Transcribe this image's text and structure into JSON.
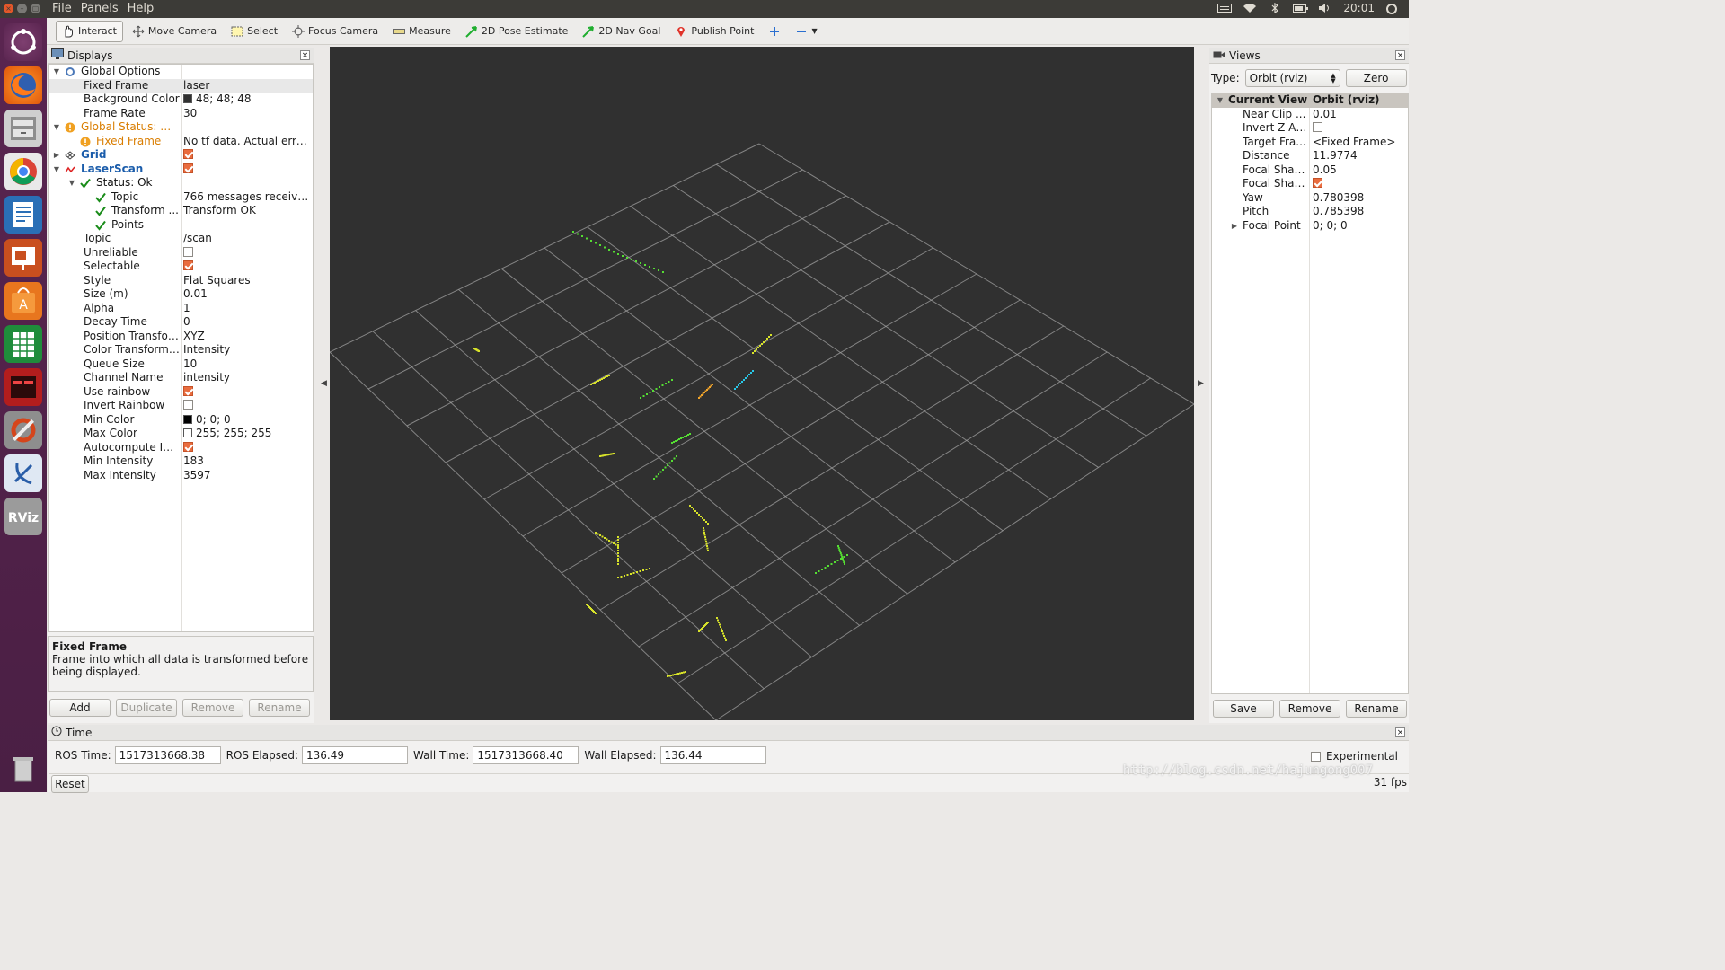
{
  "menubar": {
    "items": [
      "File",
      "Panels",
      "Help"
    ],
    "time": "20:01"
  },
  "toolbar": {
    "tools": [
      {
        "label": "Interact",
        "icon": "hand-icon",
        "active": true
      },
      {
        "label": "Move Camera",
        "icon": "move-camera-icon"
      },
      {
        "label": "Select",
        "icon": "select-icon"
      },
      {
        "label": "Focus Camera",
        "icon": "focus-camera-icon"
      },
      {
        "label": "Measure",
        "icon": "measure-icon"
      },
      {
        "label": "2D Pose Estimate",
        "icon": "pose-arrow-icon"
      },
      {
        "label": "2D Nav Goal",
        "icon": "nav-goal-arrow-icon"
      },
      {
        "label": "Publish Point",
        "icon": "map-pin-icon"
      }
    ]
  },
  "displays": {
    "title": "Displays",
    "rows": [
      {
        "name": "Global Options",
        "value": "",
        "indent": 0,
        "arrow": "down",
        "icon": "gear-icon"
      },
      {
        "name": "Fixed Frame",
        "value": "laser",
        "indent": 1,
        "selected": true
      },
      {
        "name": "Background Color",
        "value": "48; 48; 48",
        "indent": 1,
        "swatch": "#303030"
      },
      {
        "name": "Frame Rate",
        "value": "30",
        "indent": 1
      },
      {
        "name": "Global Status: W...",
        "value": "",
        "indent": 0,
        "arrow": "down",
        "icon": "warning-icon",
        "style": "warn"
      },
      {
        "name": "Fixed Frame",
        "value": "No tf data.  Actual erro...",
        "indent": 1,
        "icon": "warning-icon",
        "style": "warn"
      },
      {
        "name": "Grid",
        "value": "",
        "indent": 0,
        "arrow": "right",
        "icon": "grid-icon",
        "style": "blue",
        "check": true
      },
      {
        "name": "LaserScan",
        "value": "",
        "indent": 0,
        "arrow": "down",
        "icon": "laser-scan-icon",
        "style": "blue",
        "check": true
      },
      {
        "name": "Status: Ok",
        "value": "",
        "indent": 1,
        "arrow": "down",
        "icon": "check-icon"
      },
      {
        "name": "Topic",
        "value": "766 messages received",
        "indent": 2,
        "icon": "check-icon"
      },
      {
        "name": "Transform ...",
        "value": "Transform OK",
        "indent": 2,
        "icon": "check-icon"
      },
      {
        "name": "Points",
        "value": "",
        "indent": 2,
        "icon": "check-icon"
      },
      {
        "name": "Topic",
        "value": "/scan",
        "indent": 1
      },
      {
        "name": "Unreliable",
        "value": "",
        "indent": 1,
        "check": false
      },
      {
        "name": "Selectable",
        "value": "",
        "indent": 1,
        "check": true
      },
      {
        "name": "Style",
        "value": "Flat Squares",
        "indent": 1
      },
      {
        "name": "Size (m)",
        "value": "0.01",
        "indent": 1
      },
      {
        "name": "Alpha",
        "value": "1",
        "indent": 1
      },
      {
        "name": "Decay Time",
        "value": "0",
        "indent": 1
      },
      {
        "name": "Position Transfor...",
        "value": "XYZ",
        "indent": 1
      },
      {
        "name": "Color Transformer",
        "value": "Intensity",
        "indent": 1
      },
      {
        "name": "Queue Size",
        "value": "10",
        "indent": 1
      },
      {
        "name": "Channel Name",
        "value": "intensity",
        "indent": 1
      },
      {
        "name": "Use rainbow",
        "value": "",
        "indent": 1,
        "check": true
      },
      {
        "name": "Invert Rainbow",
        "value": "",
        "indent": 1,
        "check": false
      },
      {
        "name": "Min Color",
        "value": "0; 0; 0",
        "indent": 1,
        "swatch": "#000000"
      },
      {
        "name": "Max Color",
        "value": "255; 255; 255",
        "indent": 1,
        "swatch": "#ffffff"
      },
      {
        "name": "Autocompute Int...",
        "value": "",
        "indent": 1,
        "check": true
      },
      {
        "name": "Min Intensity",
        "value": "183",
        "indent": 1
      },
      {
        "name": "Max Intensity",
        "value": "3597",
        "indent": 1
      }
    ],
    "help_title": "Fixed Frame",
    "help_text": "Frame into which all data is transformed before being displayed.",
    "buttons": {
      "add": "Add",
      "duplicate": "Duplicate",
      "remove": "Remove",
      "rename": "Rename"
    }
  },
  "views": {
    "title": "Views",
    "type_label": "Type:",
    "type_value": "Orbit (rviz)",
    "zero": "Zero",
    "header_name": "Current View",
    "header_value": "Orbit (rviz)",
    "rows": [
      {
        "name": "Near Clip ...",
        "value": "0.01"
      },
      {
        "name": "Invert Z Axis",
        "value": "",
        "check": false
      },
      {
        "name": "Target Fra...",
        "value": "<Fixed Frame>"
      },
      {
        "name": "Distance",
        "value": "11.9774"
      },
      {
        "name": "Focal Shap...",
        "value": "0.05"
      },
      {
        "name": "Focal Shap...",
        "value": "",
        "check": true
      },
      {
        "name": "Yaw",
        "value": "0.780398"
      },
      {
        "name": "Pitch",
        "value": "0.785398"
      },
      {
        "name": "Focal Point",
        "value": "0; 0; 0",
        "arrow": "right"
      }
    ],
    "buttons": {
      "save": "Save",
      "remove": "Remove",
      "rename": "Rename"
    }
  },
  "time": {
    "title": "Time",
    "ros_time_label": "ROS Time:",
    "ros_time": "1517313668.38",
    "ros_elapsed_label": "ROS Elapsed:",
    "ros_elapsed": "136.49",
    "wall_time_label": "Wall Time:",
    "wall_time": "1517313668.40",
    "wall_elapsed_label": "Wall Elapsed:",
    "wall_elapsed": "136.44",
    "experimental": "Experimental",
    "reset": "Reset",
    "fps": "31 fps"
  },
  "watermark": "http://blog.csdn.net/hajungong007",
  "colors": {
    "viewport_bg": "#303030",
    "grid": "#a0a0a0",
    "accent": "#e96c3e"
  }
}
